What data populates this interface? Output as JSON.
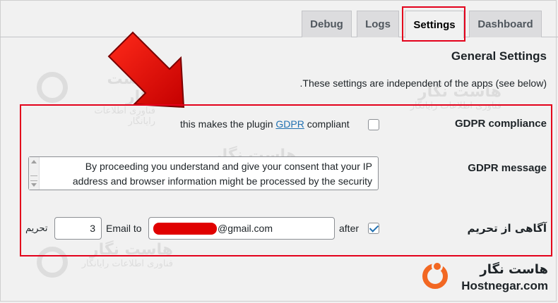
{
  "tabs": [
    {
      "label": "Debug",
      "active": false
    },
    {
      "label": "Logs",
      "active": false
    },
    {
      "label": "Settings",
      "active": true
    },
    {
      "label": "Dashboard",
      "active": false
    }
  ],
  "section": {
    "title": "General Settings",
    "description": ".These settings are independent of the apps (see below)"
  },
  "gdpr_compliance": {
    "label": "GDPR compliance",
    "checked": false,
    "text_before": "this makes the plugin ",
    "link_text": "GDPR",
    "text_after": " compliant"
  },
  "gdpr_message": {
    "label": "GDPR message",
    "value": "By proceeding you understand and give your consent that your IP address and browser information might be processed by the security"
  },
  "ban_notify": {
    "label": "آگاهی از تحریم",
    "checked": true,
    "after_text": "after",
    "email_value_suffix": "@gmail.com",
    "email_to_text": "Email to",
    "count_value": "3",
    "unit_text": "تحریم"
  },
  "watermark": {
    "name": "هاست نگار",
    "subtitle": "فناوری اطلاعات رایانگار"
  },
  "logo": {
    "name_fa": "هاست نگار",
    "name_en": "Hostnegar.com"
  },
  "colors": {
    "highlight": "#e3001b",
    "link": "#2271b1",
    "brand": "#f26722"
  }
}
